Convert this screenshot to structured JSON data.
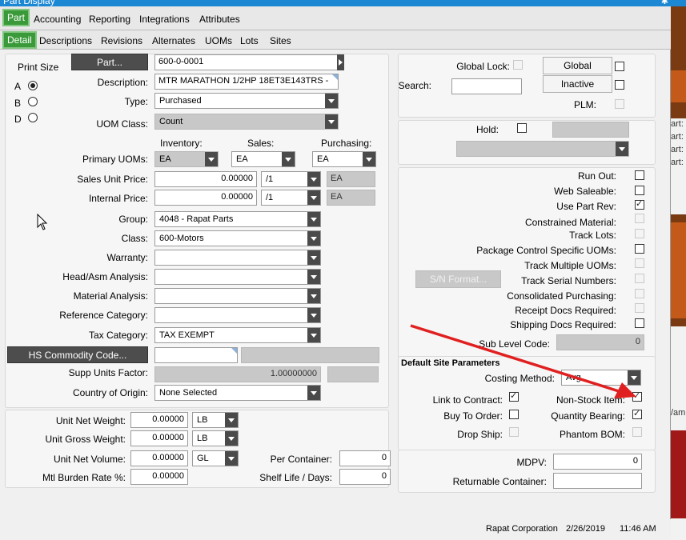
{
  "window": {
    "title": "Part Display"
  },
  "tabs_main": [
    "Part",
    "Accounting",
    "Reporting",
    "Integrations",
    "Attributes"
  ],
  "tabs_sub": [
    "Detail",
    "Descriptions",
    "Revisions",
    "Alternates",
    "UOMs",
    "Lots",
    "Sites"
  ],
  "print_size": {
    "label": "Print Size",
    "options": [
      "A",
      "B",
      "D"
    ],
    "selected": "A"
  },
  "part": {
    "part_button": "Part...",
    "part_number": "600-0-0001",
    "description_label": "Description:",
    "description": "MTR MARATHON 1/2HP 18ET3E143TRS -",
    "type_label": "Type:",
    "type": "Purchased",
    "uom_class_label": "UOM Class:",
    "uom_class": "Count"
  },
  "uoms": {
    "inventory_header": "Inventory:",
    "sales_header": "Sales:",
    "purchasing_header": "Purchasing:",
    "primary_label": "Primary UOMs:",
    "inventory": "EA",
    "sales": "EA",
    "purchasing": "EA"
  },
  "prices": {
    "sales_label": "Sales Unit Price:",
    "sales_value": "0.00000",
    "sales_per": "/1",
    "sales_uom": "EA",
    "internal_label": "Internal Price:",
    "internal_value": "0.00000",
    "internal_per": "/1",
    "internal_uom": "EA"
  },
  "classification": {
    "group_label": "Group:",
    "group": "4048 - Rapat Parts",
    "class_label": "Class:",
    "class": "600-Motors",
    "warranty_label": "Warranty:",
    "warranty": "",
    "head_label": "Head/Asm Analysis:",
    "head": "",
    "material_label": "Material Analysis:",
    "material": "",
    "refcat_label": "Reference Category:",
    "refcat": "",
    "tax_label": "Tax Category:",
    "tax": "TAX EXEMPT"
  },
  "commodity": {
    "hs_button": "HS Commodity Code...",
    "supp_label": "Supp Units Factor:",
    "supp_value": "1.00000000",
    "country_label": "Country of Origin:",
    "country": "None Selected"
  },
  "weights": {
    "net_weight_label": "Unit Net Weight:",
    "net_weight": "0.00000",
    "net_weight_uom": "LB",
    "gross_weight_label": "Unit Gross Weight:",
    "gross_weight": "0.00000",
    "gross_weight_uom": "LB",
    "net_volume_label": "Unit Net Volume:",
    "net_volume": "0.00000",
    "net_volume_uom": "GL",
    "burden_label": "Mtl Burden Rate %:",
    "burden": "0.00000",
    "per_container_label": "Per Container:",
    "per_container": "0",
    "shelf_life_label": "Shelf Life / Days:",
    "shelf_life": "0"
  },
  "global": {
    "global_lock_label": "Global Lock:",
    "global_button": "Global",
    "search_label": "Search:",
    "inactive_button": "Inactive",
    "plm_label": "PLM:"
  },
  "hold": {
    "label": "Hold:"
  },
  "flags": {
    "run_out": "Run Out:",
    "web_saleable": "Web Saleable:",
    "use_part_rev": "Use Part Rev:",
    "constrained": "Constrained Material:",
    "track_lots": "Track Lots:",
    "package_control": "Package Control Specific UOMs:",
    "track_multiple": "Track Multiple UOMs:",
    "sn_button": "S/N Format...",
    "track_serial": "Track Serial Numbers:",
    "consolidated": "Consolidated Purchasing:",
    "receipt_docs": "Receipt Docs Required:",
    "shipping_docs": "Shipping Docs Required:",
    "sub_level_label": "Sub Level Code:",
    "sub_level": "0"
  },
  "site_params": {
    "title": "Default Site Parameters",
    "costing_label": "Costing Method:",
    "costing": "Avg",
    "link_contract": "Link to Contract:",
    "non_stock": "Non-Stock Item:",
    "buy_to_order": "Buy To Order:",
    "quantity_bearing": "Quantity Bearing:",
    "drop_ship": "Drop Ship:",
    "phantom_bom": "Phantom BOM:"
  },
  "mdpv": {
    "mdpv_label": "MDPV:",
    "mdpv": "0",
    "returnable_label": "Returnable Container:",
    "returnable": ""
  },
  "status_bar": {
    "company": "Rapat Corporation",
    "date": "2/26/2019",
    "time": "11:46 AM"
  },
  "bg_text": [
    "art:",
    "art:",
    "art:",
    "art:",
    "/am"
  ],
  "colors": {
    "title_bar": "#1c88d4",
    "active_tab": "#3a9a3a",
    "annotation_arrow": "#e02020"
  }
}
